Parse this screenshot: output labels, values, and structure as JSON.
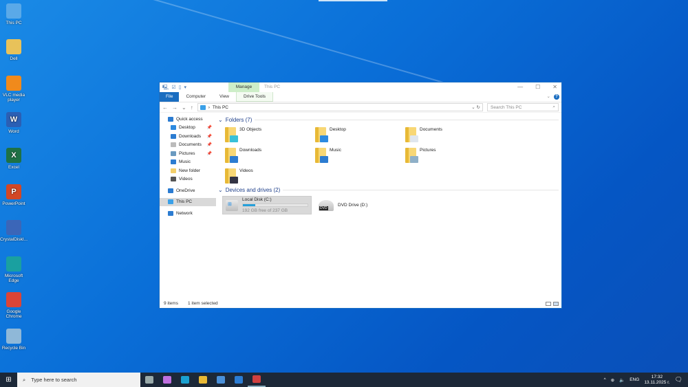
{
  "desktop": {
    "icons": [
      {
        "label": "This PC",
        "color": "#5aa9e8"
      },
      {
        "label": "Dell",
        "color": "#e8c25a"
      },
      {
        "label": "VLC media player",
        "color": "#f08a1c"
      },
      {
        "label": "Word",
        "color": "#2b5fb4"
      },
      {
        "label": "Excel",
        "color": "#1e7145"
      },
      {
        "label": "PowerPoint",
        "color": "#d24726"
      },
      {
        "label": "CrystalDiskI...",
        "color": "#3b66b8"
      },
      {
        "label": "Microsoft Edge",
        "color": "#1aa0a0"
      },
      {
        "label": "Google Chrome",
        "color": "#db4437"
      },
      {
        "label": "Recycle Bin",
        "color": "#8fb8d8"
      }
    ],
    "glyphs": [
      "",
      "",
      "",
      "W",
      "X",
      "P",
      "",
      "",
      "",
      ""
    ]
  },
  "window": {
    "title": "This PC",
    "manage_tab": "Manage",
    "tabs": [
      "File",
      "Computer",
      "View",
      "Drive Tools"
    ],
    "address": {
      "path": "This PC",
      "search_placeholder": "Search This PC"
    },
    "sidebar": [
      {
        "label": "Quick access",
        "color": "#2c7cd1"
      },
      {
        "label": "Desktop",
        "color": "#2c8ae0",
        "pin": true
      },
      {
        "label": "Downloads",
        "color": "#2c7cd1",
        "pin": true
      },
      {
        "label": "Documents",
        "color": "#bbb",
        "pin": true
      },
      {
        "label": "Pictures",
        "color": "#6a9ac0",
        "pin": true
      },
      {
        "label": "Music",
        "color": "#2c7cd1"
      },
      {
        "label": "New folder",
        "color": "#f3cf6a"
      },
      {
        "label": "Videos",
        "color": "#555"
      },
      {
        "label": "OneDrive",
        "color": "#2c7cd1"
      },
      {
        "label": "This PC",
        "color": "#3aa0e8"
      },
      {
        "label": "Network",
        "color": "#2c7cd1"
      }
    ],
    "folders_header": "Folders (7)",
    "folders": [
      {
        "name": "3D Objects",
        "overlay": "#38c0d8"
      },
      {
        "name": "Desktop",
        "overlay": "#2c8ae0"
      },
      {
        "name": "Documents",
        "overlay": "#dfe6ee"
      },
      {
        "name": "Downloads",
        "overlay": "#2c7cd1"
      },
      {
        "name": "Music",
        "overlay": "#2c7cd1"
      },
      {
        "name": "Pictures",
        "overlay": "#8fb0c8"
      },
      {
        "name": "Videos",
        "overlay": "#334"
      }
    ],
    "drives_header": "Devices and drives (2)",
    "drives": [
      {
        "name": "Local Disk (C:)",
        "free": "192 GB free of 237 GB",
        "used_fraction": 0.19
      },
      {
        "name": "DVD Drive (D:)",
        "badge": "DVD"
      }
    ],
    "status": {
      "items": "9 items",
      "selected": "1 item selected"
    }
  },
  "taskbar": {
    "search_placeholder": "Type here to search",
    "lang": "ENG",
    "time": "17:32",
    "date": "13.11.2025 г.",
    "apps": [
      "#9aa",
      "#c070e0",
      "#1aa0d0",
      "#e8b936",
      "#4a90d9",
      "#2b7cd3",
      "#d04040"
    ]
  }
}
